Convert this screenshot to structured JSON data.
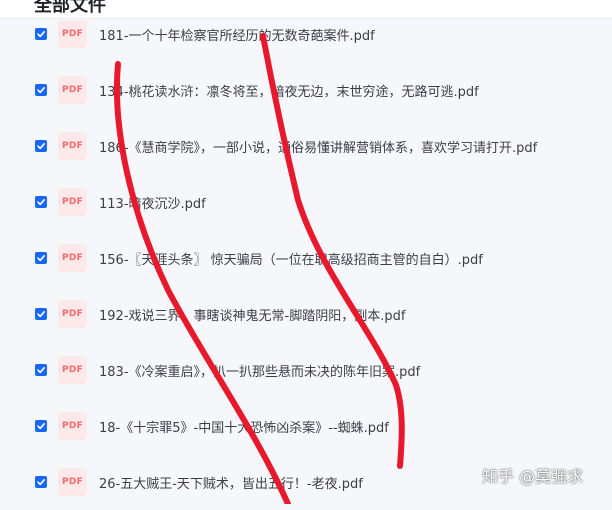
{
  "header": {
    "title": "全部文件"
  },
  "colors": {
    "accent": "#1a66ff",
    "pdf_icon_bg": "#fde9e9",
    "pdf_icon_text": "#f46a6a",
    "annotation": "#e8192c"
  },
  "icon_label": "PDF",
  "files": [
    {
      "name": "181-一个十年检察官所经历的无数奇葩案件.pdf",
      "checked": true
    },
    {
      "name": "134-桃花读水浒：凛冬将至，暗夜无边，末世穷途，无路可逃.pdf",
      "checked": true
    },
    {
      "name": "186-《慧商学院》，一部小说，通俗易懂讲解营销体系，喜欢学习请打开.pdf",
      "checked": true
    },
    {
      "name": "113-暗夜沉沙.pdf",
      "checked": true
    },
    {
      "name": "156-〖天涯头条〗 惊天骗局（一位在职高级招商主管的自白）.pdf",
      "checked": true
    },
    {
      "name": "192-戏说三界，事瞎谈神鬼无常-脚踏阴阳，副本.pdf",
      "checked": true
    },
    {
      "name": "183-《冷案重启》，扒一扒那些悬而未决的陈年旧案.pdf",
      "checked": true
    },
    {
      "name": "18-《十宗罪5》-中国十大恐怖凶杀案》--蜘蛛.pdf",
      "checked": true
    },
    {
      "name": "26-五大贼王-天下贼术，皆出五行！-老夜.pdf",
      "checked": true
    }
  ],
  "watermark": "知乎 @莫强求"
}
